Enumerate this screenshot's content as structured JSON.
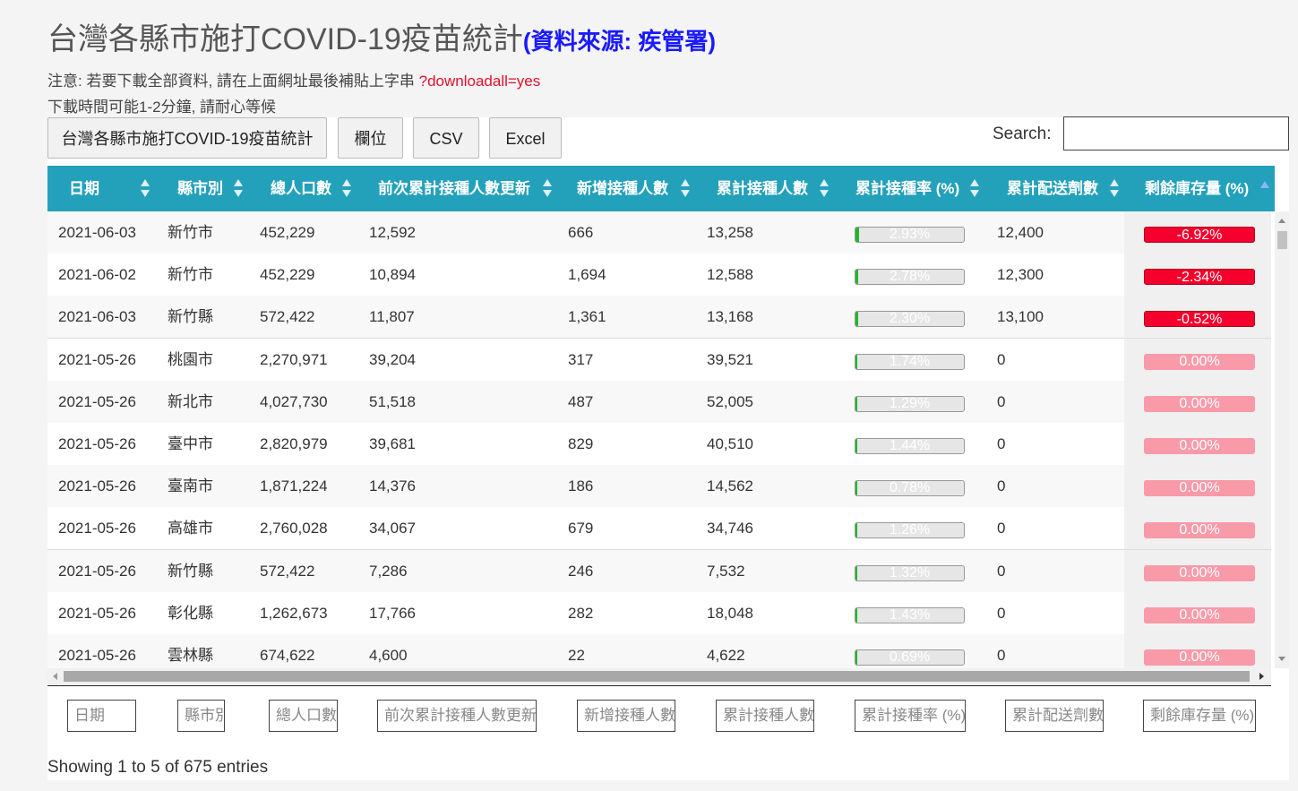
{
  "header": {
    "title": "台灣各縣市施打COVID-19疫苗統計",
    "source": "(資料來源: 疾管署)",
    "notice_prefix": "注意: 若要下載全部資料, 請在上面網址最後補貼上字串 ",
    "notice_param": "?downloadall=yes",
    "notice_line2": "下載時間可能1-2分鐘, 請耐心等候"
  },
  "toolbar": {
    "buttons": [
      "台灣各縣市施打COVID-19疫苗統計",
      "欄位",
      "CSV",
      "Excel"
    ],
    "search_label": "Search:",
    "search_value": ""
  },
  "table": {
    "columns": [
      "日期",
      "縣市別",
      "總人口數",
      "前次累計接種人數更新",
      "新增接種人數",
      "累計接種人數",
      "累計接種率 (%)",
      "累計配送劑數",
      "剩餘庫存量 (%)"
    ],
    "sorted_column": "剩餘庫存量 (%)",
    "rows": [
      {
        "date": "2021-06-03",
        "city": "新竹市",
        "pop": "452,229",
        "prev": "12,592",
        "new": "666",
        "total": "13,258",
        "rate": "2.93%",
        "rate_value": 2.93,
        "delivered": "12,400",
        "stock": "-6.92%",
        "stock_value": -6.92
      },
      {
        "date": "2021-06-02",
        "city": "新竹市",
        "pop": "452,229",
        "prev": "10,894",
        "new": "1,694",
        "total": "12,588",
        "rate": "2.78%",
        "rate_value": 2.78,
        "delivered": "12,300",
        "stock": "-2.34%",
        "stock_value": -2.34
      },
      {
        "date": "2021-06-03",
        "city": "新竹縣",
        "pop": "572,422",
        "prev": "11,807",
        "new": "1,361",
        "total": "13,168",
        "rate": "2.30%",
        "rate_value": 2.3,
        "delivered": "13,100",
        "stock": "-0.52%",
        "stock_value": -0.52
      },
      {
        "date": "2021-05-26",
        "city": "桃園市",
        "pop": "2,270,971",
        "prev": "39,204",
        "new": "317",
        "total": "39,521",
        "rate": "1.74%",
        "rate_value": 1.74,
        "delivered": "0",
        "stock": "0.00%",
        "stock_value": 0
      },
      {
        "date": "2021-05-26",
        "city": "新北市",
        "pop": "4,027,730",
        "prev": "51,518",
        "new": "487",
        "total": "52,005",
        "rate": "1.29%",
        "rate_value": 1.29,
        "delivered": "0",
        "stock": "0.00%",
        "stock_value": 0
      },
      {
        "date": "2021-05-26",
        "city": "臺中市",
        "pop": "2,820,979",
        "prev": "39,681",
        "new": "829",
        "total": "40,510",
        "rate": "1.44%",
        "rate_value": 1.44,
        "delivered": "0",
        "stock": "0.00%",
        "stock_value": 0
      },
      {
        "date": "2021-05-26",
        "city": "臺南市",
        "pop": "1,871,224",
        "prev": "14,376",
        "new": "186",
        "total": "14,562",
        "rate": "0.78%",
        "rate_value": 0.78,
        "delivered": "0",
        "stock": "0.00%",
        "stock_value": 0
      },
      {
        "date": "2021-05-26",
        "city": "高雄市",
        "pop": "2,760,028",
        "prev": "34,067",
        "new": "679",
        "total": "34,746",
        "rate": "1.26%",
        "rate_value": 1.26,
        "delivered": "0",
        "stock": "0.00%",
        "stock_value": 0
      },
      {
        "date": "2021-05-26",
        "city": "新竹縣",
        "pop": "572,422",
        "prev": "7,286",
        "new": "246",
        "total": "7,532",
        "rate": "1.32%",
        "rate_value": 1.32,
        "delivered": "0",
        "stock": "0.00%",
        "stock_value": 0
      },
      {
        "date": "2021-05-26",
        "city": "彰化縣",
        "pop": "1,262,673",
        "prev": "17,766",
        "new": "282",
        "total": "18,048",
        "rate": "1.43%",
        "rate_value": 1.43,
        "delivered": "0",
        "stock": "0.00%",
        "stock_value": 0
      },
      {
        "date": "2021-05-26",
        "city": "雲林縣",
        "pop": "674,622",
        "prev": "4,600",
        "new": "22",
        "total": "4,622",
        "rate": "0.69%",
        "rate_value": 0.69,
        "delivered": "0",
        "stock": "0.00%",
        "stock_value": 0
      }
    ],
    "filter_placeholders": [
      "日期",
      "縣市別",
      "總人口數",
      "前次累計接種人數更新",
      "新增接種人數",
      "累計接種人數",
      "累計接種率 (%)",
      "累計配送劑數",
      "剩餘庫存量 (%)"
    ]
  },
  "footer": {
    "info": "Showing 1 to 5 of 675 entries"
  },
  "colors": {
    "header_bg": "#23a1bb",
    "source_text": "#1a1aff",
    "notice_param": "#e0122c",
    "rate_fill": "#1fb82a",
    "stock_negative": "#f5002d",
    "stock_zero": "#f99aa9"
  }
}
